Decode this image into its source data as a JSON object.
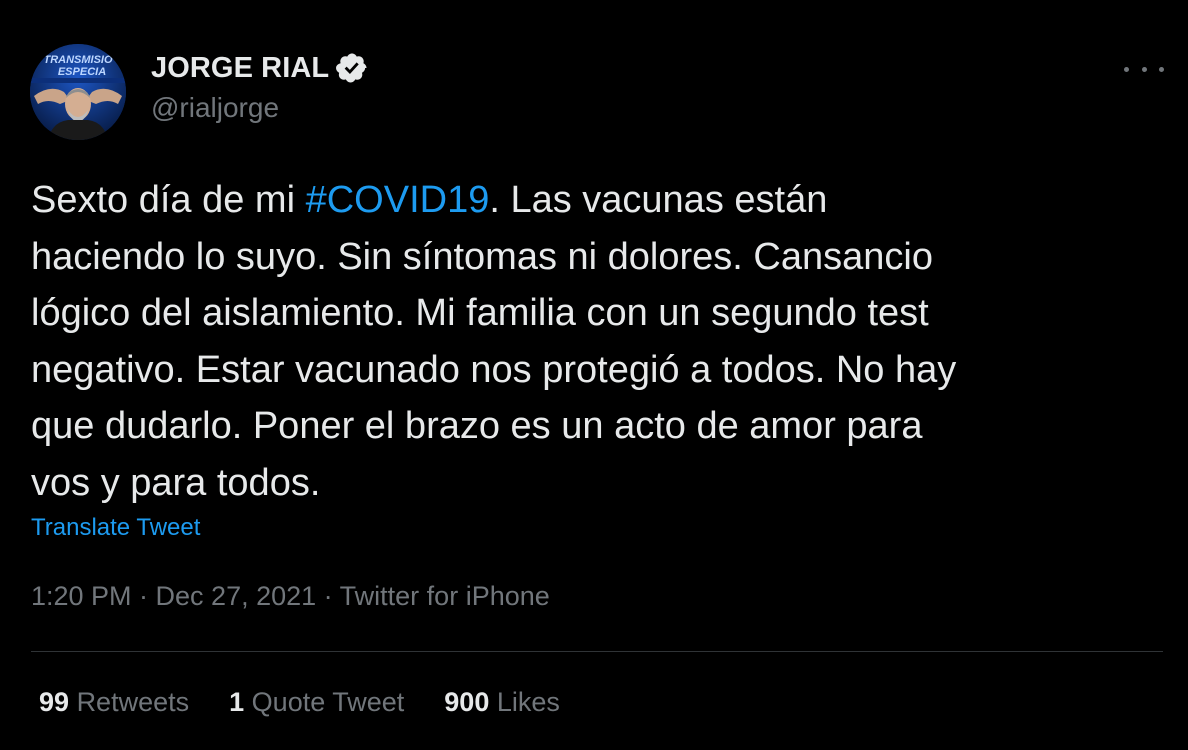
{
  "author": {
    "display_name": "JORGE RIAL",
    "handle": "@rialjorge",
    "avatar_banner_line1": "TRANSMISIÓ",
    "avatar_banner_line2": "ESPECIA"
  },
  "tweet": {
    "lines": [
      [
        {
          "text": "Sexto día de mi "
        },
        {
          "text": "#COVID19",
          "hashtag": true
        },
        {
          "text": ". Las vacunas están"
        }
      ],
      [
        {
          "text": "haciendo lo suyo. Sin síntomas ni dolores. Cansancio"
        }
      ],
      [
        {
          "text": "lógico del aislamiento. Mi familia con un segundo test"
        }
      ],
      [
        {
          "text": "negativo. Estar vacunado nos protegió a todos. No hay"
        }
      ],
      [
        {
          "text": "que dudarlo. Poner el brazo es un acto de amor para"
        }
      ],
      [
        {
          "text": "vos y para todos."
        }
      ]
    ],
    "translate_label": "Translate Tweet",
    "meta": "1:20 PM · Dec 27, 2021 · Twitter for iPhone"
  },
  "stats": {
    "retweets_count": "99",
    "retweets_label": "Retweets",
    "quotes_count": "1",
    "quotes_label": "Quote Tweet",
    "likes_count": "900",
    "likes_label": "Likes"
  },
  "icons": {
    "verified": "verified-badge-icon",
    "more": "more-horizontal-icon"
  },
  "colors": {
    "background": "#000000",
    "text": "#e7e9ea",
    "secondary": "#71767b",
    "accent": "#1d9bf0",
    "divider": "#2f3336"
  }
}
